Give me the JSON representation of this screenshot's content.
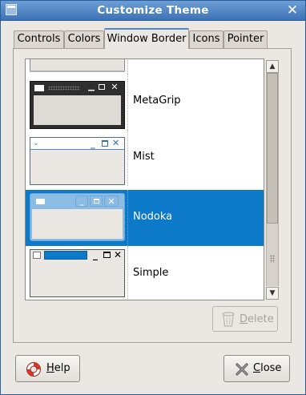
{
  "window": {
    "title": "Customize Theme",
    "close_glyph": "✕"
  },
  "tabs": [
    {
      "label": "Controls"
    },
    {
      "label": "Colors"
    },
    {
      "label": "Window Border",
      "active": true
    },
    {
      "label": "Icons"
    },
    {
      "label": "Pointer"
    }
  ],
  "themes": [
    {
      "name": ""
    },
    {
      "name": "MetaGrip"
    },
    {
      "name": "Mist"
    },
    {
      "name": "Nodoka",
      "selected": true
    },
    {
      "name": "Simple"
    }
  ],
  "buttons": {
    "delete": {
      "mnemonic": "D",
      "rest": "elete",
      "enabled": false
    },
    "help": {
      "mnemonic": "H",
      "rest": "elp"
    },
    "close": {
      "mnemonic": "C",
      "rest": "lose"
    }
  },
  "colors": {
    "selection": "#0d79c9",
    "titlebar": "#3d72b5"
  }
}
